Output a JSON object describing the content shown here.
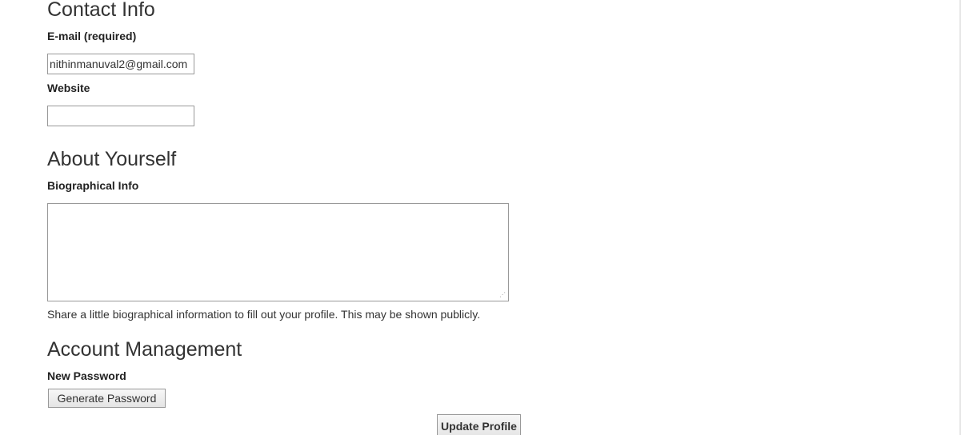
{
  "contact": {
    "heading": "Contact Info",
    "email_label": "E-mail (required)",
    "email_value": "nithinmanuval2@gmail.com",
    "website_label": "Website",
    "website_value": ""
  },
  "about": {
    "heading": "About Yourself",
    "bio_label": "Biographical Info",
    "bio_value": "",
    "bio_help": "Share a little biographical information to fill out your profile. This may be shown publicly."
  },
  "account": {
    "heading": "Account Management",
    "password_label": "New Password",
    "generate_button": "Generate Password"
  },
  "actions": {
    "update_button": "Update Profile"
  },
  "icons": {
    "resize_grip": "resize-grip-icon"
  }
}
